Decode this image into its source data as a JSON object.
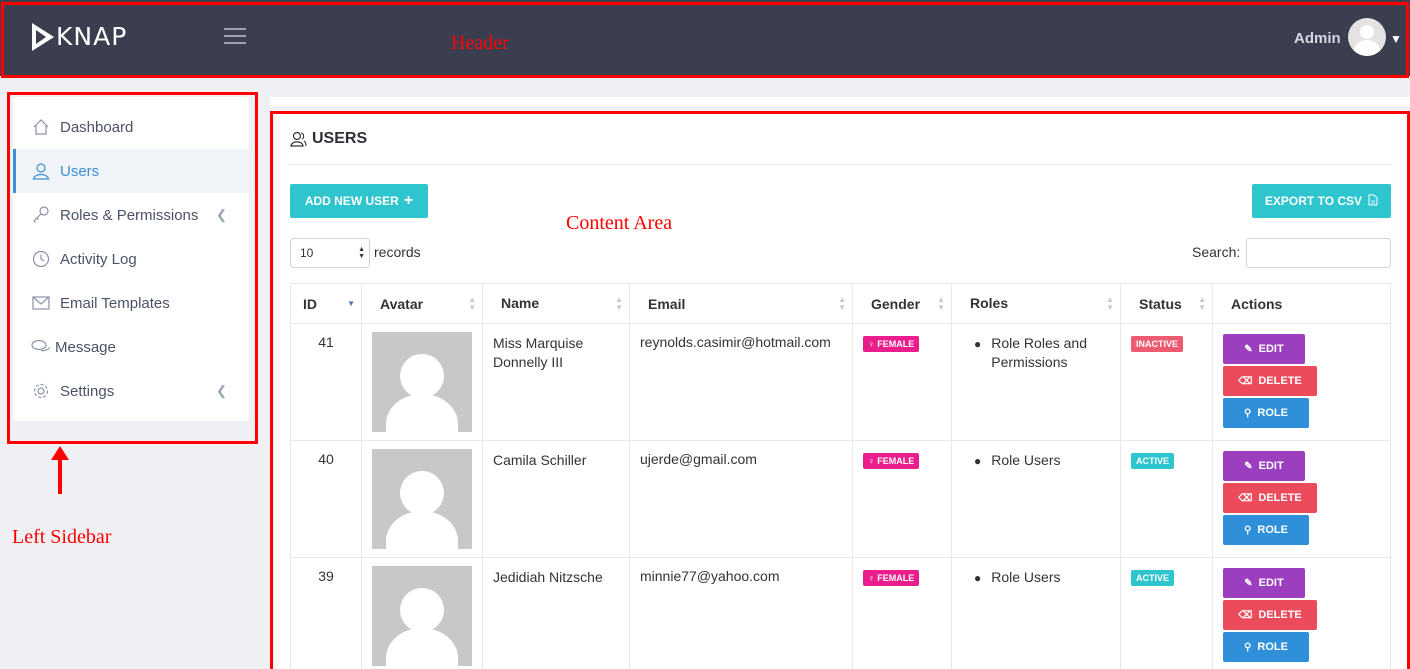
{
  "header": {
    "logo_text": "KNAP",
    "admin_label": "Admin",
    "annotation": "Header"
  },
  "sidebar": {
    "annotation": "Left Sidebar",
    "items": [
      {
        "label": "Dashboard",
        "icon": "home-icon"
      },
      {
        "label": "Users",
        "icon": "user-icon",
        "active": true
      },
      {
        "label": "Roles & Permissions",
        "icon": "key-icon"
      },
      {
        "label": "Activity Log",
        "icon": "clock-icon"
      },
      {
        "label": "Email Templates",
        "icon": "envelope-icon"
      },
      {
        "label": "Message",
        "icon": "chat-icon"
      },
      {
        "label": "Settings",
        "icon": "gear-icon"
      }
    ]
  },
  "content": {
    "annotation": "Content Area",
    "title": "USERS",
    "add_button": "ADD NEW USER",
    "export_button": "EXPORT TO CSV",
    "records_value": "10",
    "records_label": "records",
    "search_label": "Search:",
    "search_value": "",
    "columns": [
      "ID",
      "Avatar",
      "Name",
      "Email",
      "Gender",
      "Roles",
      "Status",
      "Actions"
    ],
    "rows": [
      {
        "id": "41",
        "name": "Miss Marquise Donnelly III",
        "email": "reynolds.casimir@hotmail.com",
        "gender": "FEMALE",
        "role": "Role Roles and Permissions",
        "status": "INACTIVE"
      },
      {
        "id": "40",
        "name": "Camila Schiller",
        "email": "ujerde@gmail.com",
        "gender": "FEMALE",
        "role": "Role Users",
        "status": "ACTIVE"
      },
      {
        "id": "39",
        "name": "Jedidiah Nitzsche",
        "email": "minnie77@yahoo.com",
        "gender": "FEMALE",
        "role": "Role Users",
        "status": "ACTIVE"
      }
    ],
    "actions": {
      "edit": "EDIT",
      "delete": "DELETE",
      "role": "ROLE"
    }
  },
  "colors": {
    "header_bg": "#3b3e4f",
    "accent_teal": "#2fc5cf",
    "edit": "#9c3fbf",
    "delete": "#eb4b5a",
    "role": "#2f8fd9",
    "female": "#e91e8c",
    "inactive": "#ec5b70",
    "annotation": "#ff0000"
  }
}
